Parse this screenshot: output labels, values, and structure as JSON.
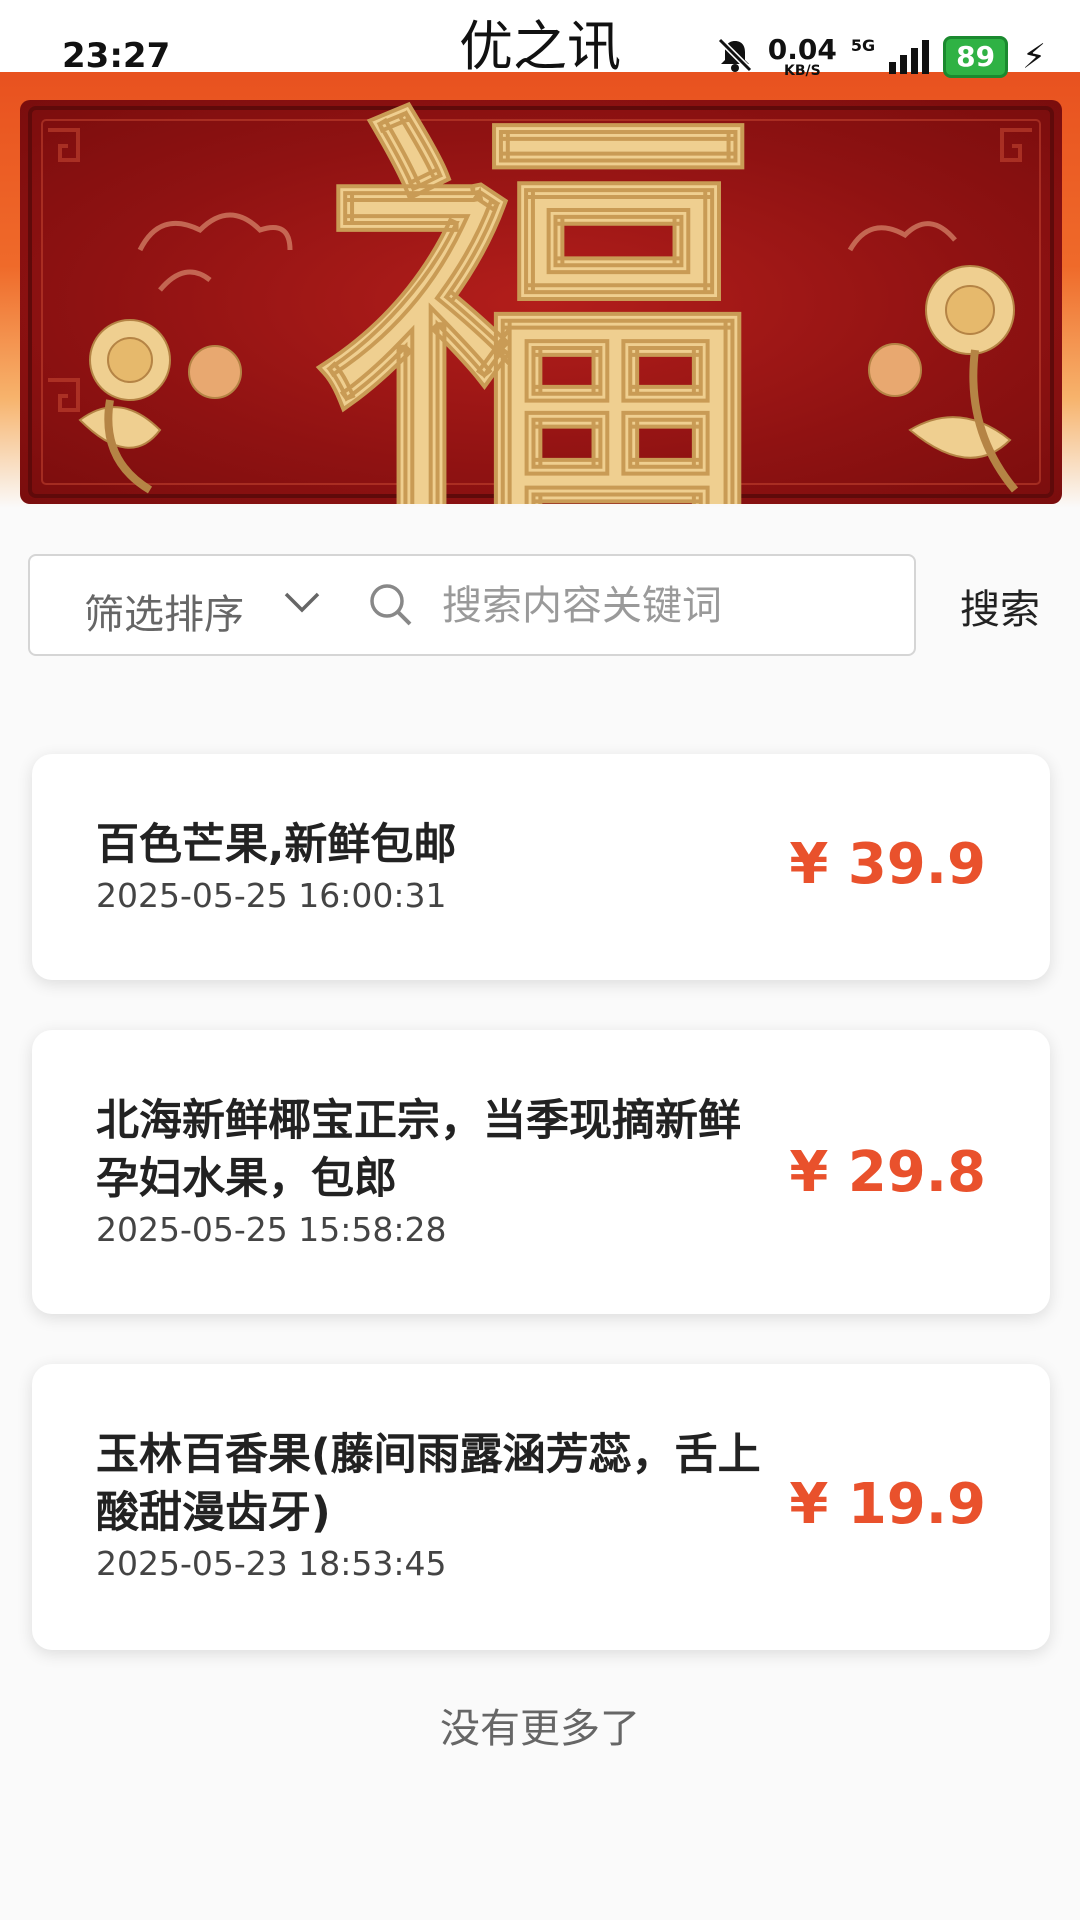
{
  "status_bar": {
    "time": "23:27",
    "net_speed": "0.04",
    "net_unit": "KB/S",
    "network": "5G",
    "battery": "89"
  },
  "app": {
    "title": "优之讯"
  },
  "banner": {
    "character": "福"
  },
  "search": {
    "sort_label": "筛选排序",
    "placeholder": "搜索内容关键词",
    "button_label": "搜索"
  },
  "listings": [
    {
      "title": "百色芒果,新鲜包邮",
      "time": "2025-05-25 16:00:31",
      "price": "¥ 39.9"
    },
    {
      "title": "北海新鲜椰宝正宗，当季现摘新鲜孕妇水果，包郎",
      "time": "2025-05-25 15:58:28",
      "price": "¥ 29.8"
    },
    {
      "title": "玉林百香果(藤间雨露涵芳蕊，舌上酸甜漫齿牙)",
      "time": "2025-05-23 18:53:45",
      "price": "¥ 19.9"
    }
  ],
  "footer": {
    "no_more": "没有更多了"
  },
  "colors": {
    "accent": "#e9512c",
    "banner_red": "#9d1515",
    "banner_gold": "#efcf90",
    "battery_green": "#2fb244"
  }
}
